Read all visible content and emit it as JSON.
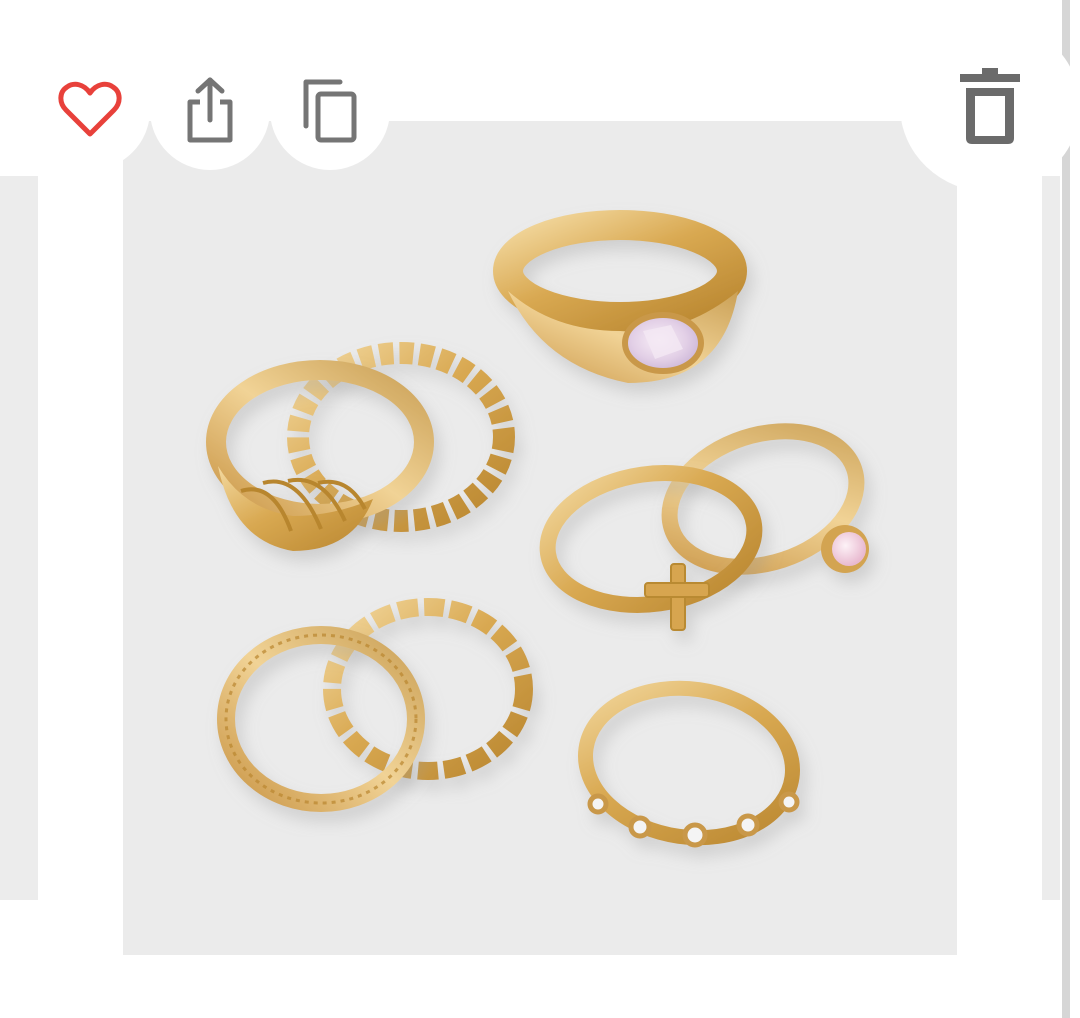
{
  "product_image": {
    "alt": "",
    "background_color": "#ebebeb"
  },
  "actions": {
    "favorite": {
      "icon": "heart-outline-icon",
      "color": "#e8413b"
    },
    "share": {
      "icon": "share-icon",
      "color": "#757575"
    },
    "copy": {
      "icon": "copy-icon",
      "color": "#757575"
    },
    "delete": {
      "icon": "trash-icon",
      "color": "#6b6b6b"
    }
  }
}
